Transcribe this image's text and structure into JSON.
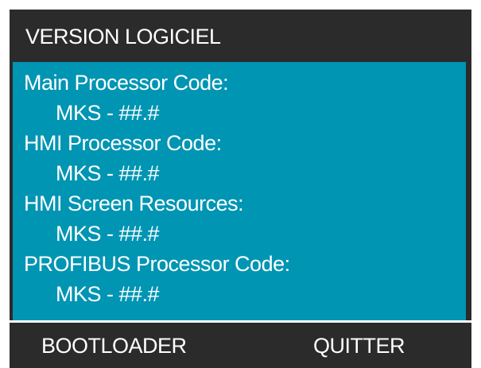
{
  "header": {
    "title": "VERSION LOGICIEL"
  },
  "versions": [
    {
      "label": "Main Processor Code:",
      "value": "MKS - ##.#"
    },
    {
      "label": "HMI Processor Code:",
      "value": "MKS - ##.#"
    },
    {
      "label": "HMI Screen Resources:",
      "value": "MKS - ##.#"
    },
    {
      "label": "PROFIBUS Processor Code:",
      "value": "MKS - ##.#"
    }
  ],
  "footer": {
    "left_key": "BOOTLOADER",
    "right_key": "QUITTER"
  },
  "colors": {
    "background": "#2b2b2b",
    "content": "#0095b3",
    "text": "#ffffff"
  }
}
